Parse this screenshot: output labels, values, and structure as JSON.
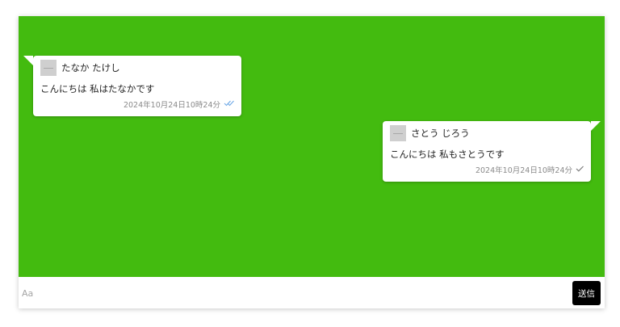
{
  "colors": {
    "chat_background": "#43bb0f",
    "bubble_background": "#ffffff",
    "read_check": "#6ea8e6",
    "sent_check": "#777777",
    "send_button": "#000000"
  },
  "messages": [
    {
      "side": "left",
      "sender_name": "たなか たけし",
      "text": "こんにちは 私はたなかです",
      "timestamp": "2024年10月24日10時24分",
      "status_icon": "double-check-icon"
    },
    {
      "side": "right",
      "sender_name": "さとう じろう",
      "text": "こんにちは 私もさとうです",
      "timestamp": "2024年10月24日10時24分",
      "status_icon": "check-icon"
    }
  ],
  "input": {
    "placeholder": "Aa",
    "value": ""
  },
  "send_button_label": "送信"
}
